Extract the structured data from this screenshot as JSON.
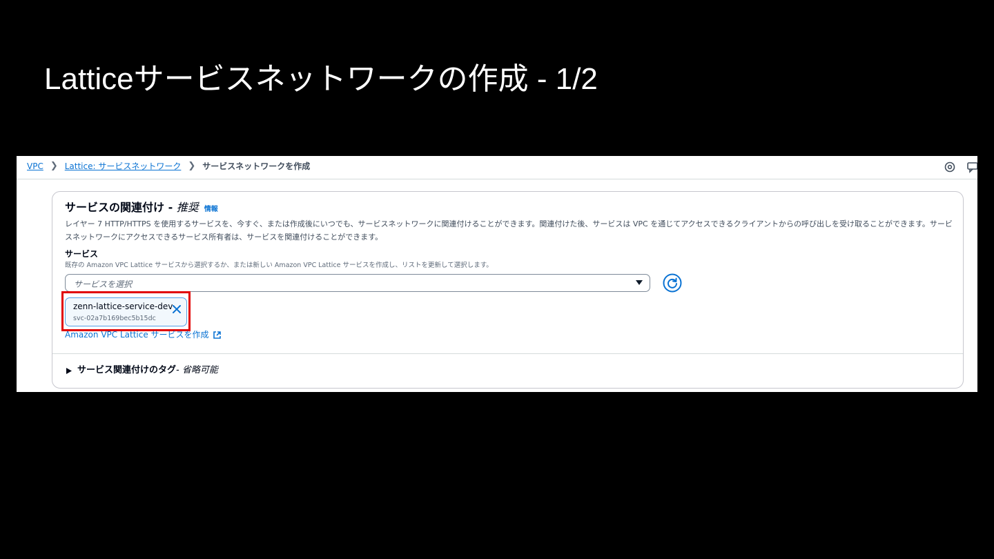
{
  "slide": {
    "title": "Latticeサービスネットワークの作成 - 1/2"
  },
  "breadcrumb": {
    "items": [
      {
        "label": "VPC"
      },
      {
        "label": "Lattice: サービスネットワーク"
      }
    ],
    "current": "サービスネットワークを作成"
  },
  "topbar": {
    "icons": [
      "settings-icon",
      "feedback-icon"
    ]
  },
  "section": {
    "title": "サービスの関連付け - ",
    "recommended": "推奨",
    "info_link": "情報",
    "description": "レイヤー 7 HTTP/HTTPS を使用するサービスを、今すぐ、または作成後にいつでも、サービスネットワークに関連付けることができます。関連付けた後、サービスは VPC を通じてアクセスできるクライアントからの呼び出しを受け取ることができます。サービスネットワークにアクセスできるサービス所有者は、サービスを関連付けることができます。"
  },
  "service_field": {
    "label": "サービス",
    "description": "既存の Amazon VPC Lattice サービスから選択するか、または新しい Amazon VPC Lattice サービスを作成し、リストを更新して選択します。",
    "placeholder": "サービスを選択",
    "selected": {
      "name": "zenn-lattice-service-dev",
      "id": "svc-02a7b169bec5b15dc"
    },
    "create_link": "Amazon VPC Lattice サービスを作成"
  },
  "tags_section": {
    "title": "サービス関連付けのタグ",
    "optional": " - 省略可能"
  },
  "colors": {
    "link": "#0972d3",
    "highlight": "#e10000",
    "token_bg": "#f2f8fd",
    "token_border": "#539fe5"
  }
}
